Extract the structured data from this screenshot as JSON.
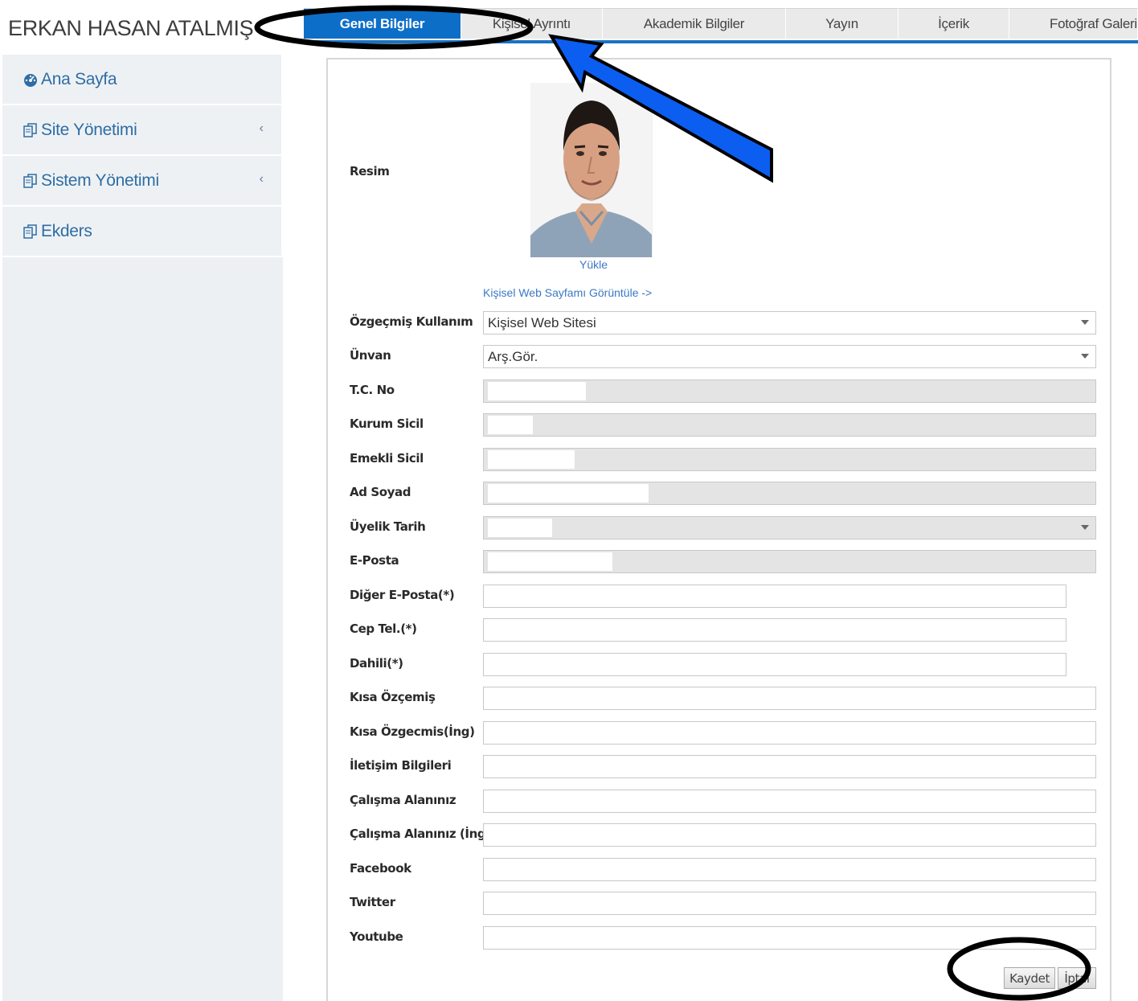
{
  "user": {
    "name": "ERKAN HASAN ATALMIŞ"
  },
  "sidebar": {
    "items": [
      {
        "label": "Ana Sayfa",
        "icon": "dashboard-icon",
        "has_chevron": false
      },
      {
        "label": "Site Yönetimi",
        "icon": "copy-icon",
        "has_chevron": true
      },
      {
        "label": "Sistem Yönetimi",
        "icon": "copy-icon",
        "has_chevron": true
      },
      {
        "label": "Ekders",
        "icon": "copy-icon",
        "has_chevron": false
      }
    ],
    "chevron": "‹"
  },
  "tabs": [
    {
      "label": "Genel Bilgiler",
      "active": true
    },
    {
      "label": "Kişisel Ayrıntı",
      "active": false
    },
    {
      "label": "Akademik Bilgiler",
      "active": false
    },
    {
      "label": "Yayın",
      "active": false
    },
    {
      "label": "İçerik",
      "active": false
    },
    {
      "label": "Fotoğraf Galerisi",
      "active": false
    }
  ],
  "form": {
    "photo_label": "Resim",
    "upload_label": "Yükle",
    "web_link": "Kişisel Web Sayfamı Görüntüle ->",
    "fields": [
      {
        "label": "Özgeçmiş Kullanım",
        "value": "Kişisel Web Sitesi",
        "type": "select",
        "disabled": false
      },
      {
        "label": "Ünvan",
        "value": "Arş.Gör.",
        "type": "select",
        "disabled": false
      },
      {
        "label": "T.C. No",
        "value": "",
        "type": "text",
        "disabled": true
      },
      {
        "label": "Kurum Sicil",
        "value": "",
        "type": "text",
        "disabled": true
      },
      {
        "label": "Emekli Sicil",
        "value": "",
        "type": "text",
        "disabled": true
      },
      {
        "label": "Ad Soyad",
        "value": "",
        "type": "text",
        "disabled": true
      },
      {
        "label": "Üyelik Tarih",
        "value": "",
        "type": "select",
        "disabled": true
      },
      {
        "label": "E-Posta",
        "value": "",
        "type": "text",
        "disabled": true
      },
      {
        "label": "Diğer E-Posta(*)",
        "value": "",
        "type": "text",
        "disabled": false
      },
      {
        "label": "Cep Tel.(*)",
        "value": "",
        "type": "text",
        "disabled": false
      },
      {
        "label": "Dahili(*)",
        "value": "",
        "type": "text",
        "disabled": false
      },
      {
        "label": "Kısa Özçemiş",
        "value": "",
        "type": "text",
        "disabled": false
      },
      {
        "label": "Kısa Özgecmis(İng)",
        "value": "",
        "type": "text",
        "disabled": false
      },
      {
        "label": "İletişim Bilgileri",
        "value": "",
        "type": "text",
        "disabled": false
      },
      {
        "label": "Çalışma Alanınız",
        "value": "",
        "type": "text",
        "disabled": false
      },
      {
        "label": "Çalışma Alanınız (İng)",
        "value": "",
        "type": "text",
        "disabled": false
      },
      {
        "label": "Facebook",
        "value": "",
        "type": "text",
        "disabled": false
      },
      {
        "label": "Twitter",
        "value": "",
        "type": "text",
        "disabled": false
      },
      {
        "label": "Youtube",
        "value": "",
        "type": "text",
        "disabled": false
      }
    ],
    "save_label": "Kaydet",
    "cancel_label": "İptal"
  },
  "colors": {
    "accent": "#0d6ec8",
    "link": "#3b78c4",
    "sidebar_text": "#2e6da4",
    "annotation_blue": "#0b5ef0",
    "annotation_black": "#000000"
  }
}
